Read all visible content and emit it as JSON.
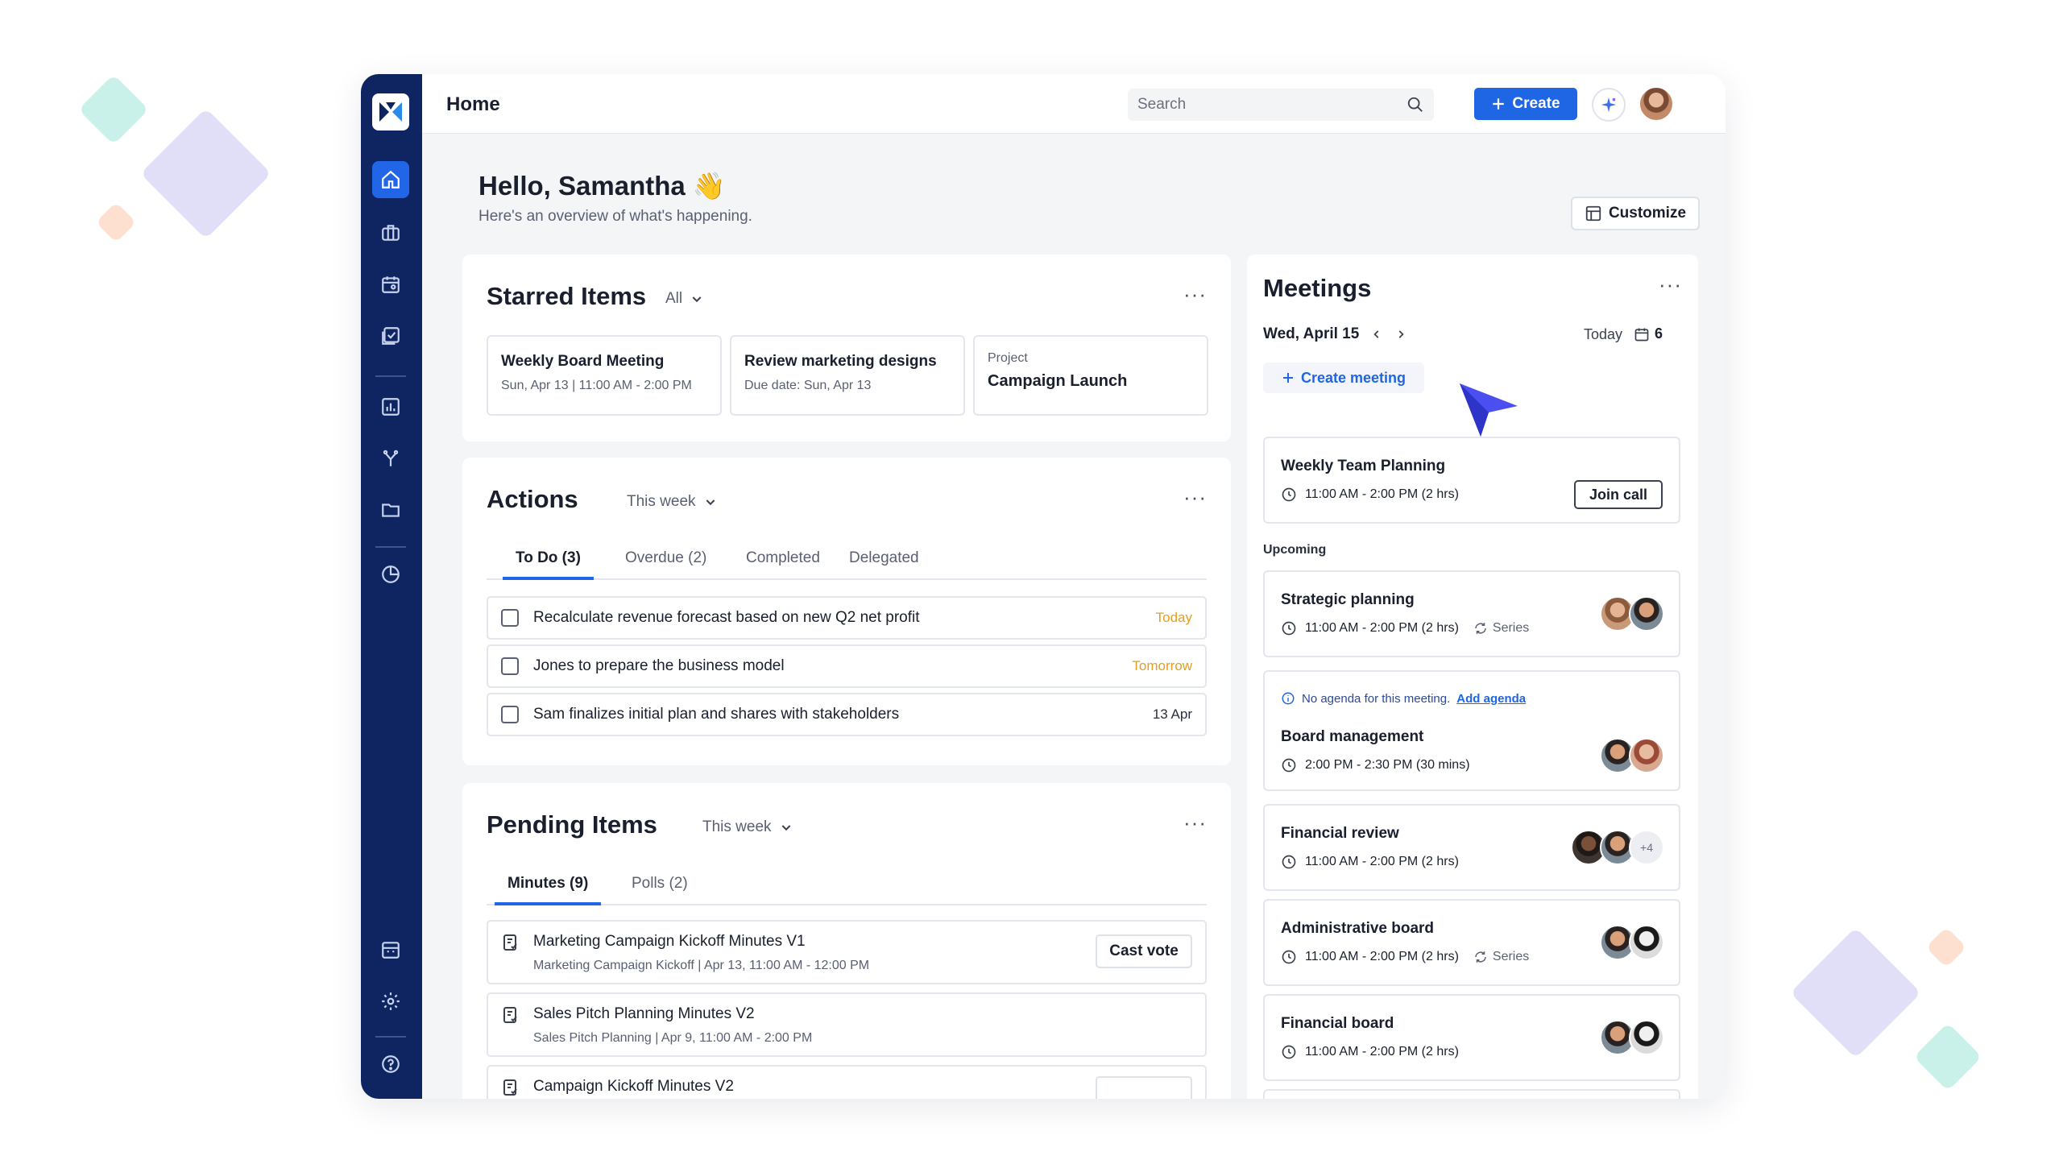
{
  "topbar": {
    "page_title": "Home",
    "search_placeholder": "Search",
    "create_label": "Create"
  },
  "sidebar": {
    "items": [
      {
        "name": "home",
        "icon": "home-icon",
        "active": true
      },
      {
        "name": "organization",
        "icon": "briefcase-icon"
      },
      {
        "name": "calendar",
        "icon": "calendar-icon"
      },
      {
        "name": "tasks",
        "icon": "checklist-icon"
      },
      {
        "name": "reports",
        "icon": "bar-chart-icon"
      },
      {
        "name": "workflows",
        "icon": "branch-icon"
      },
      {
        "name": "files",
        "icon": "folder-icon"
      },
      {
        "name": "analytics",
        "icon": "pie-chart-icon"
      },
      {
        "name": "boardroom",
        "icon": "building-icon"
      },
      {
        "name": "settings",
        "icon": "gear-icon"
      },
      {
        "name": "help",
        "icon": "help-icon"
      }
    ]
  },
  "header": {
    "greeting": "Hello, Samantha",
    "greeting_emoji": "👋",
    "subtitle": "Here's an overview of what's happening.",
    "customize_label": "Customize"
  },
  "starred": {
    "title": "Starred Items",
    "filter": "All",
    "items": [
      {
        "title": "Weekly Board Meeting",
        "sub": "Sun, Apr 13 | 11:00 AM - 2:00 PM"
      },
      {
        "title": "Review marketing designs",
        "sub": "Due date: Sun, Apr 13"
      },
      {
        "eyebrow": "Project",
        "title": "Campaign Launch"
      }
    ]
  },
  "actions": {
    "title": "Actions",
    "filter": "This week",
    "tabs": [
      "To Do (3)",
      "Overdue (2)",
      "Completed",
      "Delegated"
    ],
    "rows": [
      {
        "text": "Recalculate revenue forecast based on new Q2 net profit",
        "due": "Today",
        "due_color": "#e0a020"
      },
      {
        "text": "Jones to prepare the business model",
        "due": "Tomorrow",
        "due_color": "#e0a020"
      },
      {
        "text": "Sam finalizes initial plan and shares with stakeholders",
        "due": "13 Apr",
        "due_color": "#2a2f3e"
      }
    ]
  },
  "pending": {
    "title": "Pending Items",
    "filter": "This week",
    "tabs": [
      "Minutes (9)",
      "Polls (2)"
    ],
    "rows": [
      {
        "title": "Marketing Campaign Kickoff Minutes V1",
        "sub": "Marketing Campaign Kickoff | Apr 13, 11:00 AM - 12:00 PM",
        "button": "Cast vote"
      },
      {
        "title": "Sales Pitch Planning Minutes V2",
        "sub": "Sales Pitch Planning | Apr 9, 11:00 AM - 2:00 PM"
      },
      {
        "title": "Campaign Kickoff Minutes V2",
        "sub": ""
      }
    ]
  },
  "meetings": {
    "title": "Meetings",
    "date": "Wed, April 15",
    "today_label": "Today",
    "count": "6",
    "create_label": "Create meeting",
    "current": {
      "title": "Weekly Team Planning",
      "time": "11:00 AM - 2:00 PM (2 hrs)",
      "button": "Join call"
    },
    "upcoming_label": "Upcoming",
    "upcoming": [
      {
        "title": "Strategic planning",
        "time": "11:00 AM - 2:00 PM (2 hrs)",
        "series": "Series"
      },
      {
        "notice": "No agenda for this meeting.",
        "notice_link": "Add agenda",
        "title": "Board management",
        "time": "2:00 PM - 2:30 PM (30 mins)"
      },
      {
        "title": "Financial review",
        "time": "11:00 AM - 2:00 PM (2 hrs)",
        "more": "+4"
      },
      {
        "title": "Administrative board",
        "time": "11:00 AM - 2:00 PM (2 hrs)",
        "series": "Series"
      },
      {
        "title": "Financial board",
        "time": "11:00 AM - 2:00 PM (2 hrs)"
      }
    ]
  },
  "colors": {
    "sidebar_bg": "#0e2561",
    "accent": "#1f66e5",
    "due_warning": "#e0a020"
  }
}
